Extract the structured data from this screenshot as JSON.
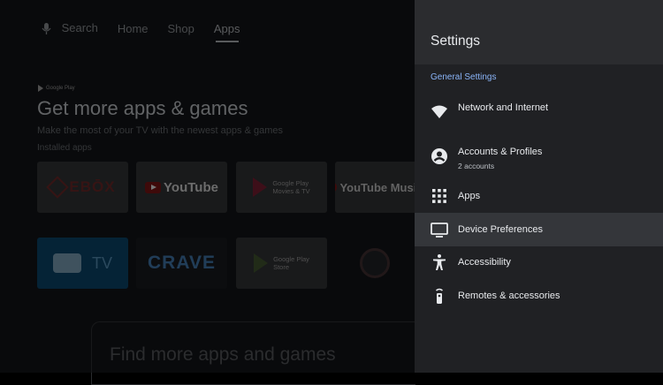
{
  "topnav": {
    "search": "Search",
    "home": "Home",
    "shop": "Shop",
    "apps": "Apps"
  },
  "hero": {
    "badge": "Google Play",
    "title": "Get more apps & games",
    "subtitle": "Make the most of your TV with the newest apps & games",
    "installed_label": "Installed apps"
  },
  "tiles": {
    "ebox": "EBŌX",
    "youtube": "YouTube",
    "gp_movies": [
      "Google Play",
      "Movies & TV"
    ],
    "youtube_music": "YouTube Music",
    "tv": "TV",
    "crave": "CRAVE",
    "gp_store": [
      "Google Play",
      "Store"
    ]
  },
  "find_more": "Find more apps and games",
  "settings": {
    "title": "Settings",
    "section": "General Settings",
    "items": [
      {
        "title": "Network and Internet",
        "subtitle": "",
        "icon": "wifi-icon"
      },
      {
        "title": "Accounts & Profiles",
        "subtitle": "2 accounts",
        "icon": "account-circle-icon"
      },
      {
        "title": "Apps",
        "subtitle": "",
        "icon": "apps-grid-icon"
      },
      {
        "title": "Device Preferences",
        "subtitle": "",
        "icon": "tv-monitor-icon"
      },
      {
        "title": "Accessibility",
        "subtitle": "",
        "icon": "accessibility-icon"
      },
      {
        "title": "Remotes & accessories",
        "subtitle": "",
        "icon": "remote-icon"
      }
    ],
    "focused_index": 3
  },
  "colors": {
    "accent": "#8ab4f8",
    "panel": "#202124",
    "panel_header": "#2b2c2f",
    "focused_row": "#34363a"
  }
}
